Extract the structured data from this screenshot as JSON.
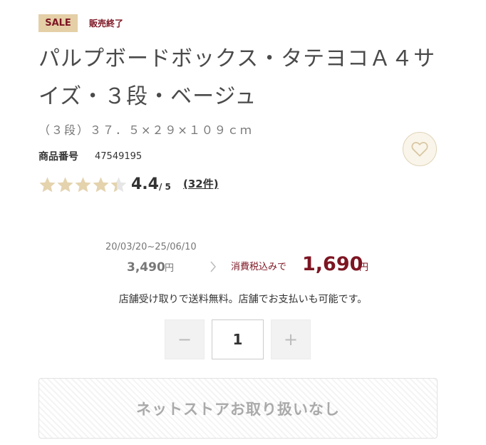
{
  "badge": {
    "sale": "SALE",
    "status": "販売終了"
  },
  "product": {
    "title": "パルプボードボックス・タテヨコＡ４サイズ・３段・ベージュ",
    "subtitle": "（３段）３７．５×２９×１０９ｃｍ",
    "code_label": "商品番号",
    "code_value": "47549195"
  },
  "rating": {
    "value": "4.4",
    "max": "/ 5",
    "stars_filled": 4.4,
    "reviews": "(32件)",
    "star_color": "#e4d3ad",
    "star_empty_color": "#e6e6e6"
  },
  "price": {
    "period": "20/03/20~25/06/10",
    "original": "3,490",
    "original_unit": "円",
    "tax_label": "消費税込みで",
    "current": "1,690",
    "current_unit": "円",
    "accent": "#7d1522"
  },
  "store_note": "店舗受け取りで送料無料。店舗でお支払いも可能です。",
  "quantity": {
    "minus": "−",
    "value": "1",
    "plus": "+"
  },
  "cart_button": "ネットストアお取り扱いなし",
  "icons": {
    "favorite": "heart-icon",
    "arrow": "chevron-right-icon"
  }
}
